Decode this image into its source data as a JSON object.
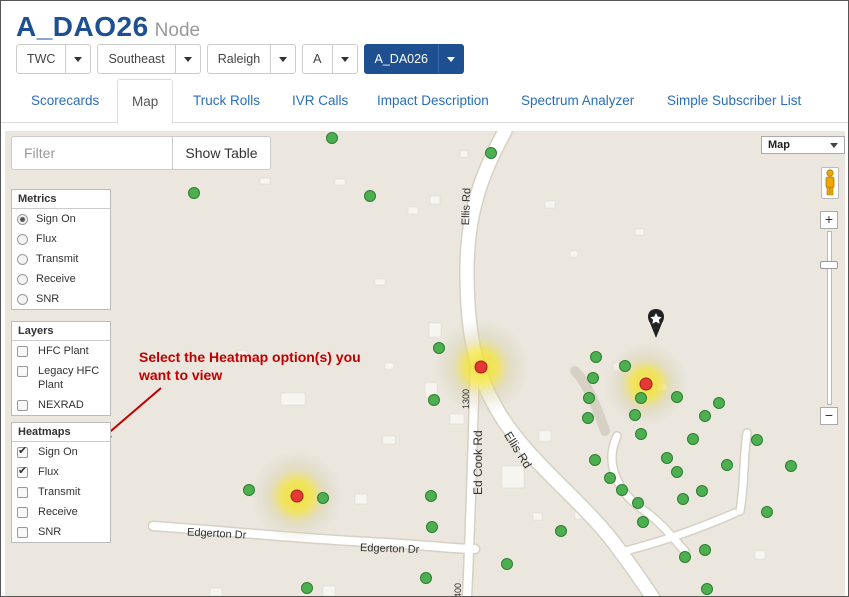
{
  "node": {
    "title": "A_DAO26",
    "subtitle": "Node"
  },
  "selectors": [
    {
      "label": "TWC"
    },
    {
      "label": "Southeast"
    },
    {
      "label": "Raleigh"
    },
    {
      "label": "A"
    },
    {
      "label": "A_DA026",
      "active": true
    }
  ],
  "tabs": [
    {
      "label": "Scorecards"
    },
    {
      "label": "Map",
      "active": true
    },
    {
      "label": "Truck Rolls"
    },
    {
      "label": "IVR Calls"
    },
    {
      "label": "Impact Description"
    },
    {
      "label": "Spectrum Analyzer"
    },
    {
      "label": "Simple Subscriber List"
    }
  ],
  "map": {
    "filter_placeholder": "Filter",
    "show_table_label": "Show Table",
    "map_type": "Map",
    "zoom_in": "+",
    "zoom_out": "−",
    "metrics": {
      "title": "Metrics",
      "options": [
        "Sign On",
        "Flux",
        "Transmit",
        "Receive",
        "SNR"
      ],
      "selected": "Sign On"
    },
    "layers": {
      "title": "Layers",
      "options": [
        "HFC Plant",
        "Legacy HFC Plant",
        "NEXRAD"
      ]
    },
    "heatmaps": {
      "title": "Heatmaps",
      "options": [
        {
          "label": "Sign On",
          "checked": true
        },
        {
          "label": "Flux",
          "checked": true
        },
        {
          "label": "Transmit",
          "checked": false
        },
        {
          "label": "Receive",
          "checked": false
        },
        {
          "label": "SNR",
          "checked": false
        }
      ]
    },
    "annotation": "Select the Heatmap option(s) you want to view",
    "road_labels": {
      "ellis_rd_1": "Ellis Rd",
      "ellis_rd_2": "Ellis Rd",
      "ed_cook_rd": "Ed Cook Rd",
      "route_1300": "1300",
      "route_1400": "400",
      "edgerton_1": "Edgerton Dr",
      "edgerton_2": "Edgerton Dr"
    },
    "colors": {
      "map_bg": "#ebe7de",
      "road": "#ffffff",
      "good_marker": "#4caf50",
      "alert_marker": "#e53935",
      "heat": "#f2e233",
      "annotation": "#c00000",
      "brand": "#1d4f91"
    }
  }
}
